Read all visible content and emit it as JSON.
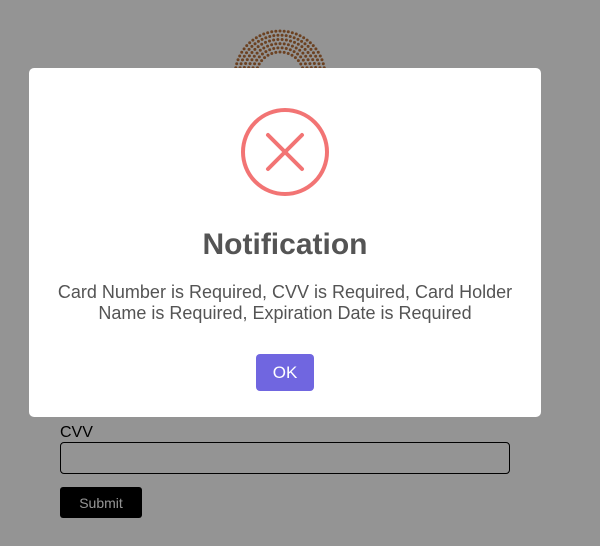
{
  "form": {
    "cvv_label": "CVV",
    "cvv_value": "",
    "submit_label": "Submit"
  },
  "modal": {
    "icon": "error-x-icon",
    "title": "Notification",
    "message": "Card Number is Required, CVV is Required, Card Holder Name is Required, Expiration Date is Required",
    "ok_label": "OK"
  },
  "colors": {
    "accent": "#7066e0",
    "error": "#f27474",
    "logo": "#b8703a"
  }
}
